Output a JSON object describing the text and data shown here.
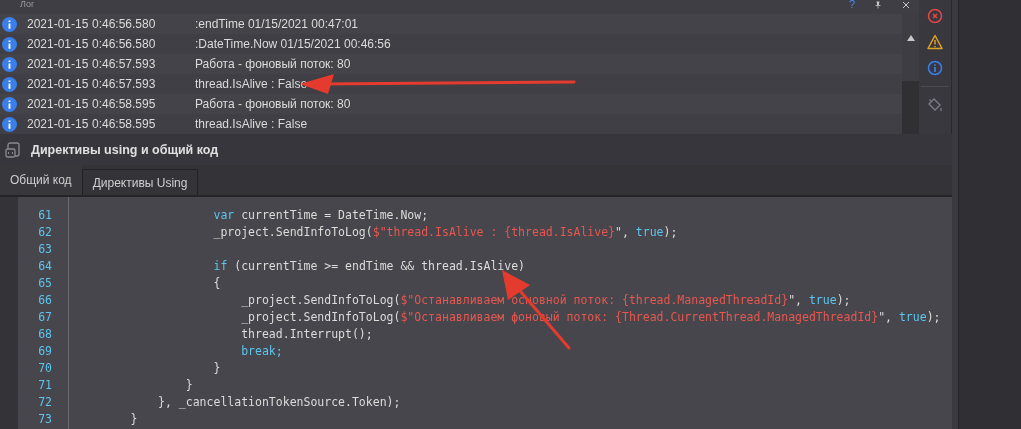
{
  "log_panel": {
    "title": "Лог",
    "help": "?",
    "rows": [
      {
        "kind": "info",
        "date": "2021-01-15",
        "time": "0:46:56.580",
        "message": ":endTime 01/15/2021 00:47:01"
      },
      {
        "kind": "info",
        "date": "2021-01-15",
        "time": "0:46:56.580",
        "message": ":DateTime.Now 01/15/2021 00:46:56"
      },
      {
        "kind": "info",
        "date": "2021-01-15",
        "time": "0:46:57.593",
        "message": "Работа - фоновый поток: 80"
      },
      {
        "kind": "info",
        "date": "2021-01-15",
        "time": "0:46:57.593",
        "message": "thread.IsAlive : False"
      },
      {
        "kind": "info",
        "date": "2021-01-15",
        "time": "0:46:58.595",
        "message": "Работа - фоновый поток: 80"
      },
      {
        "kind": "info",
        "date": "2021-01-15",
        "time": "0:46:58.595",
        "message": "thread.IsAlive : False"
      }
    ]
  },
  "code_panel": {
    "title": "Директивы using и общий код",
    "tabs": [
      {
        "label": "Общий код",
        "selected": true
      },
      {
        "label": "Директивы Using",
        "selected": false
      }
    ],
    "lines": [
      {
        "number": "61",
        "tokens": [
          {
            "kind": "keyword",
            "text": "                    var"
          },
          {
            "kind": "plain",
            "text": " currentTime = DateTime.Now;"
          }
        ]
      },
      {
        "number": "62",
        "tokens": [
          {
            "kind": "plain",
            "text": "                    _project.SendInfoToLog("
          },
          {
            "kind": "string",
            "text": "$\"thread.IsAlive : {thread.IsAlive}"
          },
          {
            "kind": "plain",
            "text": "\", "
          },
          {
            "kind": "keyword",
            "text": "true"
          },
          {
            "kind": "plain",
            "text": ");"
          }
        ]
      },
      {
        "number": "63"
      },
      {
        "number": "64",
        "tokens": [
          {
            "kind": "keyword",
            "text": "                    if"
          },
          {
            "kind": "plain",
            "text": " (currentTime >= endTime && thread.IsAlive)"
          }
        ]
      },
      {
        "number": "65",
        "tokens": [
          {
            "kind": "plain",
            "text": "                    {"
          }
        ]
      },
      {
        "number": "66",
        "tokens": [
          {
            "kind": "plain",
            "text": "                        _project.SendInfoToLog("
          },
          {
            "kind": "string",
            "text": "$\"Останавливаем основной поток: {thread.ManagedThreadId}"
          },
          {
            "kind": "plain",
            "text": "\", "
          },
          {
            "kind": "keyword",
            "text": "true"
          },
          {
            "kind": "plain",
            "text": ");"
          }
        ]
      },
      {
        "number": "67",
        "tokens": [
          {
            "kind": "plain",
            "text": "                        _project.SendInfoToLog("
          },
          {
            "kind": "string",
            "text": "$\"Останавливаем фоновый поток: {Thread.CurrentThread.ManagedThreadId}"
          },
          {
            "kind": "plain",
            "text": "\", "
          },
          {
            "kind": "keyword",
            "text": "true"
          },
          {
            "kind": "plain",
            "text": ");"
          }
        ]
      },
      {
        "number": "68",
        "tokens": [
          {
            "kind": "plain",
            "text": "                        thread.Interrupt();"
          }
        ]
      },
      {
        "number": "69",
        "tokens": [
          {
            "kind": "keyword",
            "text": "                        break;"
          }
        ]
      },
      {
        "number": "70",
        "tokens": [
          {
            "kind": "plain",
            "text": "                    }"
          }
        ]
      },
      {
        "number": "71",
        "tokens": [
          {
            "kind": "plain",
            "text": "                }"
          }
        ]
      },
      {
        "number": "72",
        "tokens": [
          {
            "kind": "plain",
            "text": "            }, _cancellationTokenSource.Token);"
          }
        ]
      },
      {
        "number": "73",
        "tokens": [
          {
            "kind": "plain",
            "text": "        }"
          }
        ]
      }
    ]
  }
}
